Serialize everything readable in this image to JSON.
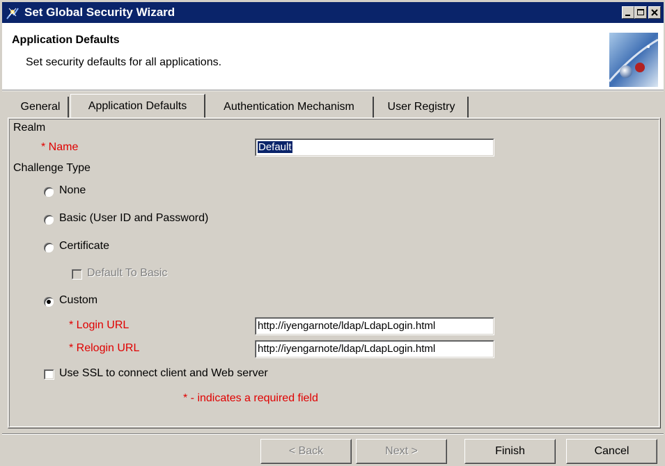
{
  "window": {
    "title": "Set Global Security Wizard"
  },
  "header": {
    "title": "Application Defaults",
    "subtitle": "Set security defaults for all applications."
  },
  "tabs": [
    {
      "label": "General",
      "active": false
    },
    {
      "label": "Application Defaults",
      "active": true
    },
    {
      "label": "Authentication Mechanism",
      "active": false
    },
    {
      "label": "User Registry",
      "active": false
    }
  ],
  "form": {
    "realm_label": "Realm",
    "name_label": "* Name",
    "name_value": "Default",
    "challenge_label": "Challenge Type",
    "options": [
      {
        "label": "None",
        "checked": false
      },
      {
        "label": "Basic (User ID and Password)",
        "checked": false
      },
      {
        "label": "Certificate",
        "checked": false
      },
      {
        "label": "Custom",
        "checked": true
      }
    ],
    "default_to_basic_label": "Default To Basic",
    "login_url_label": "* Login URL",
    "login_url_value": "http://iyengarnote/ldap/LdapLogin.html",
    "relogin_url_label": "* Relogin URL",
    "relogin_url_value": "http://iyengarnote/ldap/LdapLogin.html",
    "ssl_label": "Use SSL to connect client and Web server",
    "required_note": "* - indicates a required field"
  },
  "buttons": {
    "back": "< Back",
    "next": "Next >",
    "finish": "Finish",
    "cancel": "Cancel"
  },
  "colors": {
    "titlebar": "#0a246a",
    "required_text": "#e00000",
    "face": "#d4d0c8"
  }
}
